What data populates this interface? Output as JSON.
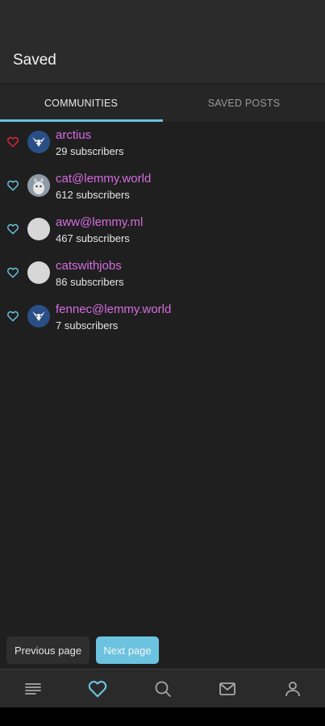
{
  "header": {
    "title": "Saved"
  },
  "tabs": [
    {
      "label": "COMMUNITIES",
      "active": true
    },
    {
      "label": "SAVED POSTS",
      "active": false
    }
  ],
  "communities": [
    {
      "name": "arctius",
      "subscribers": "29 subscribers",
      "heart_color": "#e0263a",
      "avatar": "fox"
    },
    {
      "name": "cat@lemmy.world",
      "subscribers": "612 subscribers",
      "heart_color": "#6cc3e0",
      "avatar": "cat"
    },
    {
      "name": "aww@lemmy.ml",
      "subscribers": "467 subscribers",
      "heart_color": "#6cc3e0",
      "avatar": "blank"
    },
    {
      "name": "catswithjobs",
      "subscribers": "86 subscribers",
      "heart_color": "#6cc3e0",
      "avatar": "blank"
    },
    {
      "name": "fennec@lemmy.world",
      "subscribers": "7 subscribers",
      "heart_color": "#6cc3e0",
      "avatar": "fox"
    }
  ],
  "pagination": {
    "prev_label": "Previous page",
    "next_label": "Next page"
  },
  "bottom_nav": [
    {
      "icon": "menu-icon",
      "active": false
    },
    {
      "icon": "heart-icon",
      "active": true
    },
    {
      "icon": "search-icon",
      "active": false
    },
    {
      "icon": "mail-icon",
      "active": false
    },
    {
      "icon": "profile-icon",
      "active": false
    }
  ],
  "colors": {
    "accent": "#6cc3e0",
    "community_name": "#d66de0",
    "favorite": "#e0263a"
  }
}
